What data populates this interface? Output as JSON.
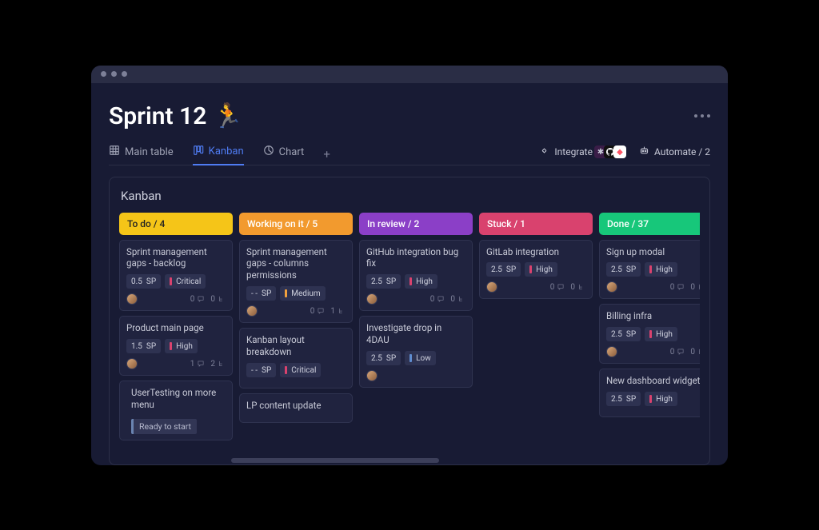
{
  "page": {
    "title": "Sprint 12",
    "emoji": "🏃"
  },
  "tabs": {
    "main": "Main table",
    "kanban": "Kanban",
    "chart": "Chart"
  },
  "actions": {
    "integrate": "Integrate",
    "automate": "Automate / 2"
  },
  "board": {
    "title": "Kanban"
  },
  "columns": [
    {
      "label": "To do / 4",
      "color": "#f5c518"
    },
    {
      "label": "Working on it / 5",
      "color": "#f29a2e"
    },
    {
      "label": "In review / 2",
      "color": "#8b3fc7"
    },
    {
      "label": "Stuck / 1",
      "color": "#d9426e"
    },
    {
      "label": "Done / 37",
      "color": "#17c77a"
    }
  ],
  "priority_colors": {
    "critical": "#d9426e",
    "high": "#d9426e",
    "medium": "#f2a13e",
    "low": "#5f8ccf"
  },
  "cards": {
    "todo": [
      {
        "title": "Sprint management gaps - backlog",
        "sp": "0.5",
        "prio": "Critical",
        "pcolor": "#d9426e",
        "c": "0",
        "s": "0"
      },
      {
        "title": "Product main page",
        "sp": "1.5",
        "prio": "High",
        "pcolor": "#d9426e",
        "c": "1",
        "s": "2"
      },
      {
        "title": "UserTesting on more menu",
        "status": "Ready to start"
      }
    ],
    "working": [
      {
        "title": "Sprint management gaps - columns permissions",
        "sp": "- -",
        "prio": "Medium",
        "pcolor": "#f2a13e",
        "c": "0",
        "s": "1"
      },
      {
        "title": "Kanban layout breakdown",
        "sp": "- -",
        "prio": "Critical",
        "pcolor": "#d9426e"
      },
      {
        "title": "LP content update"
      }
    ],
    "review": [
      {
        "title": "GitHub integration bug fix",
        "sp": "2.5",
        "prio": "High",
        "pcolor": "#d9426e",
        "c": "0",
        "s": "0"
      },
      {
        "title": "Investigate drop in 4DAU",
        "sp": "2.5",
        "prio": "Low",
        "pcolor": "#5f8ccf"
      }
    ],
    "stuck": [
      {
        "title": "GitLab integration",
        "sp": "2.5",
        "prio": "High",
        "pcolor": "#d9426e",
        "c": "0",
        "s": "0"
      }
    ],
    "done": [
      {
        "title": "Sign up modal",
        "sp": "2.5",
        "prio": "High",
        "pcolor": "#d9426e",
        "c": "0",
        "s": "0"
      },
      {
        "title": "Billing infra",
        "sp": "2.5",
        "prio": "High",
        "pcolor": "#d9426e",
        "c": "0",
        "s": "0"
      },
      {
        "title": "New dashboard widget",
        "sp": "2.5",
        "prio": "High",
        "pcolor": "#d9426e"
      }
    ]
  },
  "sp_label": "SP"
}
